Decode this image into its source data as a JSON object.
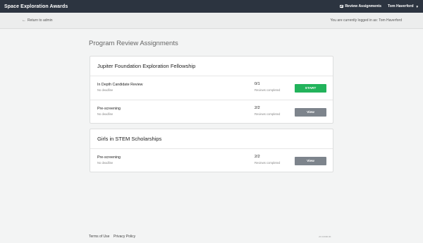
{
  "header": {
    "brand": "Space Exploration Awards",
    "review_assignments": "Review Assignments",
    "user_name": "Tom Haverford"
  },
  "subbar": {
    "return_link": "Return to admin",
    "logged_in_text": "You are currently logged in as: Tom Haverford"
  },
  "page": {
    "title": "Program Review Assignments"
  },
  "programs": [
    {
      "name": "Jupiter Foundation Exploration Fellowship",
      "stages": [
        {
          "name": "In Depth Candidate Review",
          "deadline": "No deadline",
          "count": "0/1",
          "count_label": "Reviews completed",
          "action": "START"
        },
        {
          "name": "Pre-screening",
          "deadline": "No deadline",
          "count": "2/2",
          "count_label": "Reviews completed",
          "action": "View"
        }
      ]
    },
    {
      "name": "Girls in STEM Scholarships",
      "stages": [
        {
          "name": "Pre-screening",
          "deadline": "No deadline",
          "count": "2/2",
          "count_label": "Reviews completed",
          "action": "View"
        }
      ]
    }
  ],
  "footer": {
    "terms": "Terms of Use",
    "privacy": "Privacy Policy",
    "version": "v6.0.0000.00"
  },
  "colors": {
    "topbar": "#2c3440",
    "start_button": "#22b35b",
    "view_button": "#7d848c",
    "background": "#f3f4f4"
  },
  "icons": {
    "review_assignments": "list-icon",
    "user_menu": "caret-down-icon",
    "return": "arrow-left-icon"
  }
}
